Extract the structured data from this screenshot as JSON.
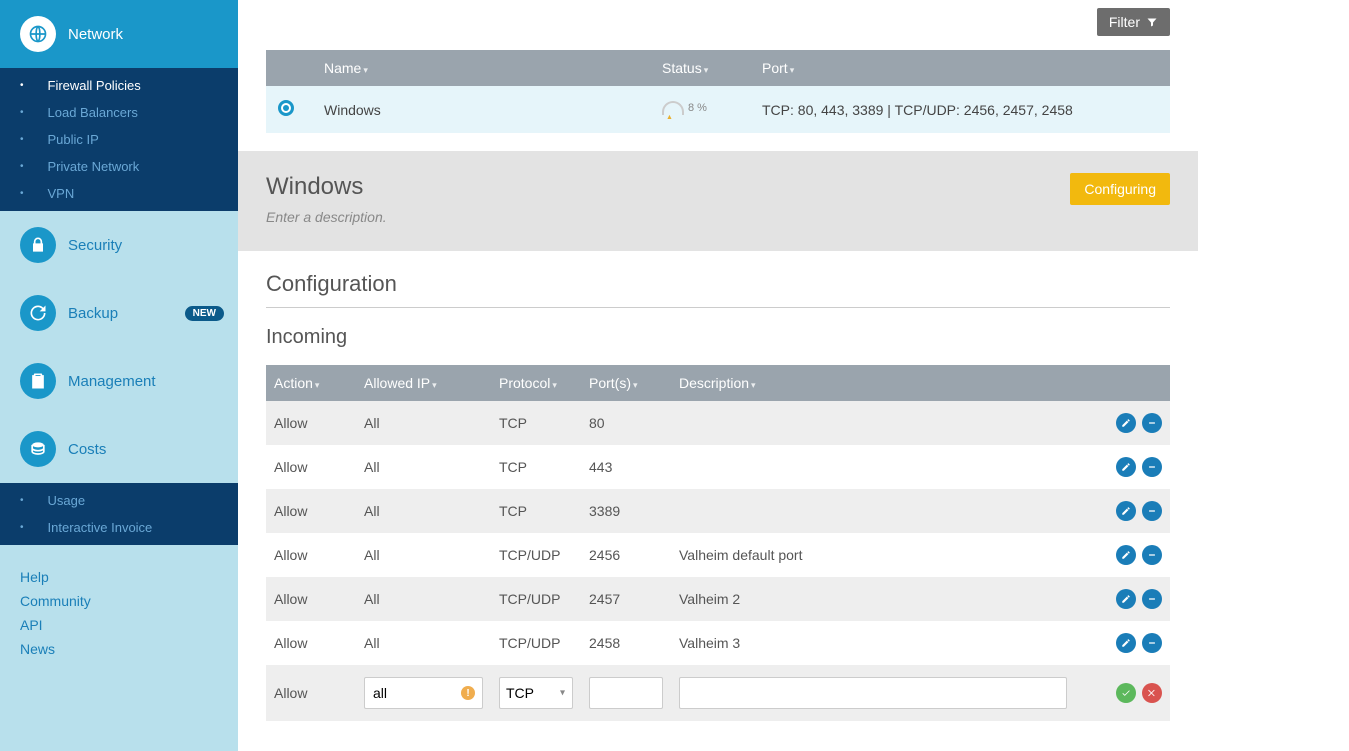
{
  "sidebar": {
    "nav": [
      {
        "key": "network",
        "label": "Network",
        "active": true
      },
      {
        "key": "security",
        "label": "Security"
      },
      {
        "key": "backup",
        "label": "Backup",
        "badge": "NEW"
      },
      {
        "key": "management",
        "label": "Management"
      },
      {
        "key": "costs",
        "label": "Costs"
      }
    ],
    "network_sub": [
      {
        "label": "Firewall Policies",
        "active": true
      },
      {
        "label": "Load Balancers"
      },
      {
        "label": "Public IP"
      },
      {
        "label": "Private Network"
      },
      {
        "label": "VPN"
      }
    ],
    "costs_sub": [
      {
        "label": "Usage"
      },
      {
        "label": "Interactive Invoice"
      }
    ],
    "footer_links": [
      "Help",
      "Community",
      "API",
      "News"
    ]
  },
  "filter_label": "Filter",
  "policy_list": {
    "columns": {
      "name": "Name",
      "status": "Status",
      "port": "Port"
    },
    "rows": [
      {
        "name": "Windows",
        "status_pct": "8 %",
        "port": "TCP: 80, 443, 3389 | TCP/UDP: 2456, 2457, 2458"
      }
    ]
  },
  "detail": {
    "title": "Windows",
    "desc_placeholder": "Enter a description.",
    "status": "Configuring"
  },
  "config": {
    "section_title": "Configuration",
    "incoming_title": "Incoming",
    "columns": {
      "action": "Action",
      "allowed_ip": "Allowed IP",
      "protocol": "Protocol",
      "ports": "Port(s)",
      "description": "Description"
    },
    "rules": [
      {
        "action": "Allow",
        "allowed_ip": "All",
        "protocol": "TCP",
        "ports": "80",
        "description": ""
      },
      {
        "action": "Allow",
        "allowed_ip": "All",
        "protocol": "TCP",
        "ports": "443",
        "description": ""
      },
      {
        "action": "Allow",
        "allowed_ip": "All",
        "protocol": "TCP",
        "ports": "3389",
        "description": ""
      },
      {
        "action": "Allow",
        "allowed_ip": "All",
        "protocol": "TCP/UDP",
        "ports": "2456",
        "description": "Valheim default port"
      },
      {
        "action": "Allow",
        "allowed_ip": "All",
        "protocol": "TCP/UDP",
        "ports": "2457",
        "description": "Valheim 2"
      },
      {
        "action": "Allow",
        "allowed_ip": "All",
        "protocol": "TCP/UDP",
        "ports": "2458",
        "description": "Valheim 3"
      }
    ],
    "new_rule": {
      "action": "Allow",
      "ip_value": "all",
      "protocol_value": "TCP",
      "ports_value": "",
      "description_value": ""
    }
  }
}
